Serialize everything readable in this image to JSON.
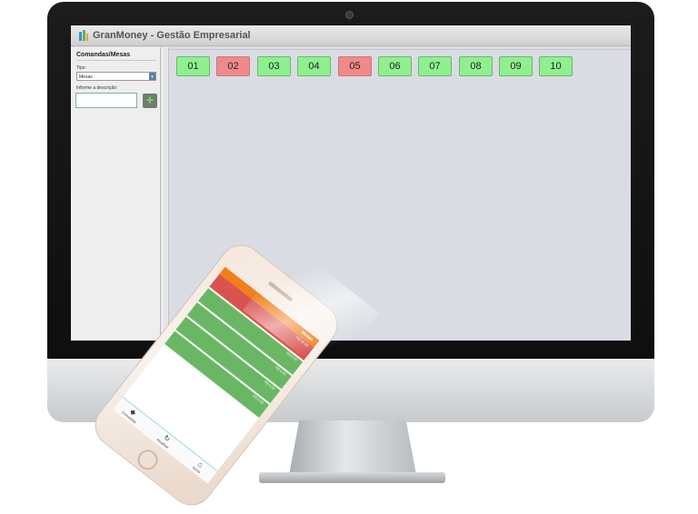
{
  "app": {
    "title": "GranMoney - Gestão Empresarial"
  },
  "sidebar": {
    "heading": "Comandas/Mesas",
    "tipo_label": "Tipo:",
    "tipo_value": "Mesas",
    "desc_label": "Informe a descrição:",
    "desc_value": "",
    "add_icon": "plus-icon"
  },
  "tables": [
    {
      "label": "01",
      "status": "free"
    },
    {
      "label": "02",
      "status": "busy"
    },
    {
      "label": "03",
      "status": "free"
    },
    {
      "label": "04",
      "status": "free"
    },
    {
      "label": "05",
      "status": "busy"
    },
    {
      "label": "06",
      "status": "free"
    },
    {
      "label": "07",
      "status": "free"
    },
    {
      "label": "08",
      "status": "free"
    },
    {
      "label": "09",
      "status": "free"
    },
    {
      "label": "10",
      "status": "free"
    }
  ],
  "colors": {
    "free": "#8ff08f",
    "busy": "#f08a8a",
    "phone_header": "#f07f1b"
  },
  "phone": {
    "header_text": "Mesas",
    "rows": [
      {
        "text": "R$ 96,00",
        "status": "busy"
      },
      {
        "text": "R$ 0,00",
        "status": "free"
      },
      {
        "text": "R$ 0,00",
        "status": "free"
      },
      {
        "text": "R$ 0,00",
        "status": "free"
      },
      {
        "text": "R$ 0,00",
        "status": "free"
      }
    ],
    "tabs": [
      {
        "label": "Comandas",
        "icon": "tag-icon"
      },
      {
        "label": "Atualizar",
        "icon": "refresh-icon"
      },
      {
        "label": "Início",
        "icon": "home-icon"
      }
    ]
  }
}
